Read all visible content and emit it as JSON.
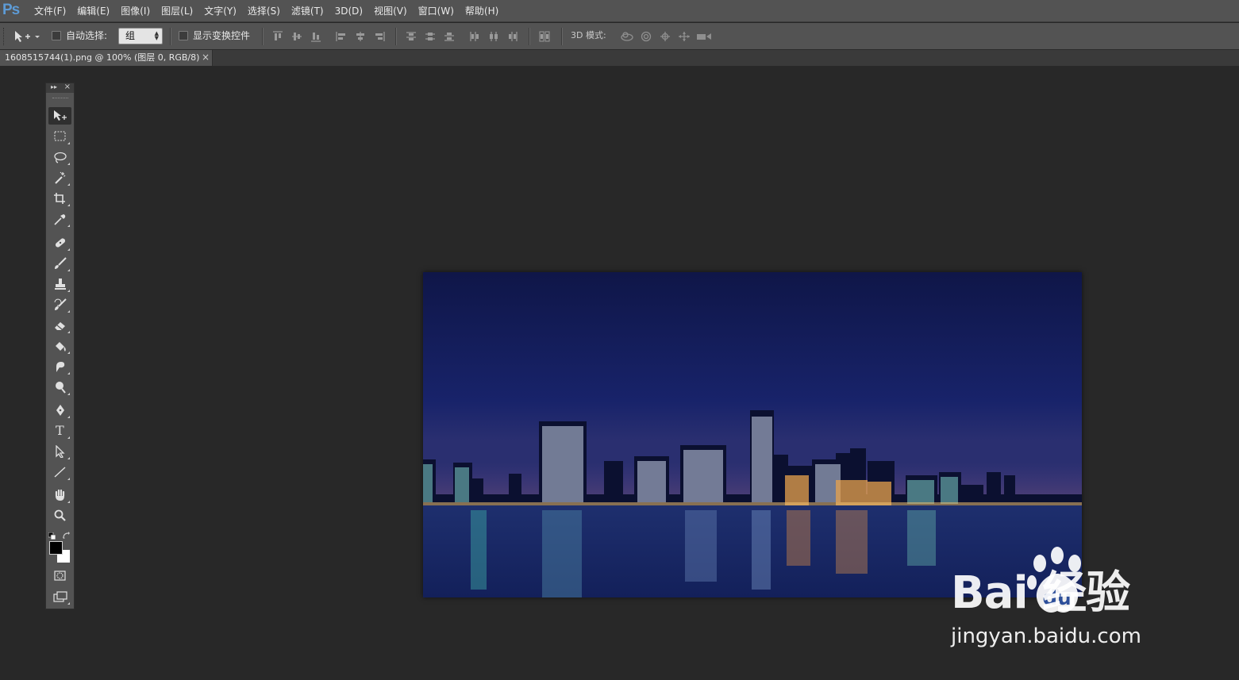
{
  "app": {
    "logo": "Ps"
  },
  "menu": [
    "文件(F)",
    "编辑(E)",
    "图像(I)",
    "图层(L)",
    "文字(Y)",
    "选择(S)",
    "滤镜(T)",
    "3D(D)",
    "视图(V)",
    "窗口(W)",
    "帮助(H)"
  ],
  "options": {
    "auto_select_label": "自动选择:",
    "auto_select_value": "组",
    "show_transform_label": "显示变换控件",
    "mode_3d_label": "3D 模式:"
  },
  "document": {
    "tab_title": "1608515744(1).png @ 100% (图层 0, RGB/8)",
    "close_glyph": "×"
  },
  "tools_panel": {
    "collapse_glyph": "▸▸",
    "close_glyph": "×",
    "type_tool_glyph": "T",
    "tools": [
      "move-tool",
      "marquee-tool",
      "lasso-tool",
      "magic-wand-tool",
      "crop-tool",
      "eyedropper-tool",
      "healing-brush-tool",
      "brush-tool",
      "clone-stamp-tool",
      "history-brush-tool",
      "eraser-tool",
      "paint-bucket-tool",
      "blur-tool",
      "dodge-tool",
      "pen-tool",
      "type-tool",
      "path-selection-tool",
      "line-tool",
      "hand-tool",
      "zoom-tool"
    ],
    "foreground_color": "#000000",
    "background_color": "#ffffff"
  },
  "canvas_image": {
    "subject": "city-skyline-night",
    "sky_color": "#141c55",
    "water_color": "#1b2a66"
  },
  "watermark": {
    "brand": "Bai  经验",
    "url": "jingyan.baidu.com"
  }
}
